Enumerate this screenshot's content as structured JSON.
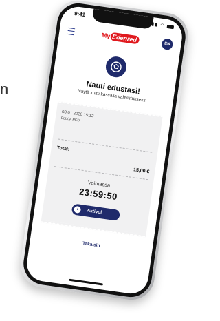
{
  "side_text": "n",
  "status_bar": {
    "time": "9:41"
  },
  "app_bar": {
    "logo_prefix": "My",
    "logo_name": "Edenred",
    "language": "EN"
  },
  "page": {
    "title": "Nauti edustasi!",
    "subtitle": "Näytä kuitti kassalla vahvistukseksi"
  },
  "receipt": {
    "datetime": "08.01.2020 15:12",
    "merchant": "ELIXIA REDI",
    "total_label": "Total:",
    "total_value": "15,00 €",
    "valid_label": "Voimassa:",
    "timer": "23:59:50"
  },
  "actions": {
    "activate_label": "Aktivoi",
    "back_label": "Takaisin"
  },
  "colors": {
    "brand_navy": "#1f2a6b",
    "brand_red": "#e0191e"
  },
  "icons": {
    "hero": "soccer-ball-icon",
    "menu": "menu-icon",
    "activate": "chevron-right-icon"
  }
}
